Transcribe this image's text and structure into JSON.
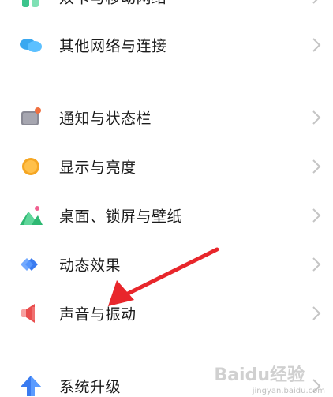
{
  "settings": {
    "items": [
      {
        "label": "双卡与移动网络",
        "icon": "dual-sim-icon",
        "color": "#3cc48c"
      },
      {
        "label": "其他网络与连接",
        "icon": "cloud-connection-icon",
        "color": "#3aa8f0"
      },
      {
        "label": "通知与状态栏",
        "icon": "notification-icon",
        "color": "#8a8a95"
      },
      {
        "label": "显示与亮度",
        "icon": "brightness-icon",
        "color": "#f5a623"
      },
      {
        "label": "桌面、锁屏与壁纸",
        "icon": "wallpaper-icon",
        "color": "#2eb872"
      },
      {
        "label": "动态效果",
        "icon": "dynamic-effect-icon",
        "color": "#3a7bf0"
      },
      {
        "label": "声音与振动",
        "icon": "speaker-icon",
        "color": "#e94e4e"
      },
      {
        "label": "系统升级",
        "icon": "upgrade-arrow-icon",
        "color": "#3a7bf0"
      }
    ]
  },
  "watermark": {
    "brand": "Baidu经验",
    "url": "jingyan.baidu.com"
  },
  "colors": {
    "text": "#1c1c1c",
    "chevron": "#c4c4c4",
    "annotation_arrow": "#e8262b"
  }
}
